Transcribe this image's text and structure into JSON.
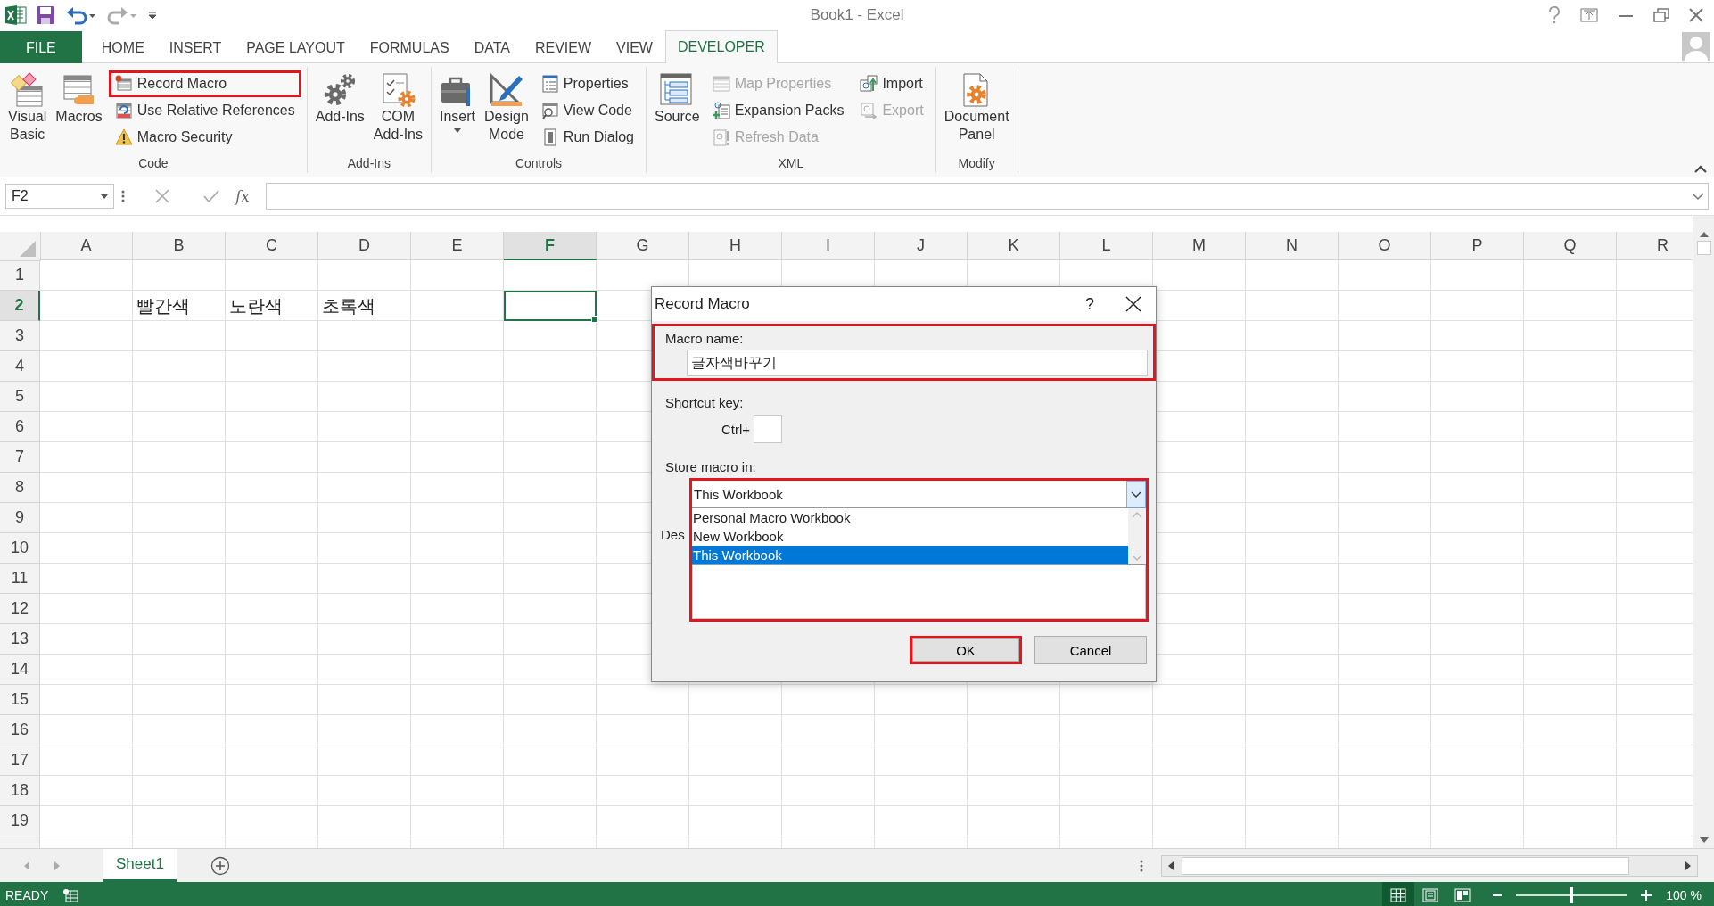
{
  "window": {
    "title": "Book1 - Excel"
  },
  "tabs": [
    {
      "label": "FILE",
      "kind": "file",
      "selected": false
    },
    {
      "label": "HOME",
      "kind": "tab",
      "selected": false
    },
    {
      "label": "INSERT",
      "kind": "tab",
      "selected": false
    },
    {
      "label": "PAGE LAYOUT",
      "kind": "tab",
      "selected": false
    },
    {
      "label": "FORMULAS",
      "kind": "tab",
      "selected": false
    },
    {
      "label": "DATA",
      "kind": "tab",
      "selected": false
    },
    {
      "label": "REVIEW",
      "kind": "tab",
      "selected": false
    },
    {
      "label": "VIEW",
      "kind": "tab",
      "selected": false
    },
    {
      "label": "DEVELOPER",
      "kind": "tab",
      "selected": true
    }
  ],
  "ribbon": {
    "groups": [
      {
        "label": "Code",
        "items": [
          {
            "label": "Visual Basic",
            "kind": "large",
            "dropdown": false,
            "disabled": false,
            "highlighted": false
          },
          {
            "label": "Macros",
            "kind": "large",
            "dropdown": false,
            "disabled": false,
            "highlighted": false
          },
          {
            "label": "Record Macro",
            "kind": "small",
            "dropdown": false,
            "disabled": false,
            "highlighted": true
          },
          {
            "label": "Use Relative References",
            "kind": "small",
            "dropdown": false,
            "disabled": false,
            "highlighted": false
          },
          {
            "label": "Macro Security",
            "kind": "small",
            "dropdown": false,
            "disabled": false,
            "highlighted": false
          }
        ]
      },
      {
        "label": "Add-Ins",
        "items": [
          {
            "label": "Add-Ins",
            "kind": "large",
            "dropdown": false,
            "disabled": false,
            "highlighted": false
          },
          {
            "label": "COM Add-Ins",
            "kind": "large",
            "dropdown": false,
            "disabled": false,
            "highlighted": false
          }
        ]
      },
      {
        "label": "Controls",
        "items": [
          {
            "label": "Insert",
            "kind": "large",
            "dropdown": true,
            "disabled": false,
            "highlighted": false
          },
          {
            "label": "Design Mode",
            "kind": "large",
            "dropdown": false,
            "disabled": false,
            "highlighted": false
          },
          {
            "label": "Properties",
            "kind": "small",
            "dropdown": false,
            "disabled": false,
            "highlighted": false
          },
          {
            "label": "View Code",
            "kind": "small",
            "dropdown": false,
            "disabled": false,
            "highlighted": false
          },
          {
            "label": "Run Dialog",
            "kind": "small",
            "dropdown": false,
            "disabled": false,
            "highlighted": false
          }
        ]
      },
      {
        "label": "XML",
        "items": [
          {
            "label": "Source",
            "kind": "large",
            "dropdown": false,
            "disabled": false,
            "highlighted": false
          },
          {
            "label": "Map Properties",
            "kind": "small",
            "dropdown": false,
            "disabled": true,
            "highlighted": false
          },
          {
            "label": "Expansion Packs",
            "kind": "small",
            "dropdown": false,
            "disabled": false,
            "highlighted": false
          },
          {
            "label": "Refresh Data",
            "kind": "small",
            "dropdown": false,
            "disabled": true,
            "highlighted": false
          },
          {
            "label": "Import",
            "kind": "small",
            "dropdown": false,
            "disabled": false,
            "highlighted": false
          },
          {
            "label": "Export",
            "kind": "small",
            "dropdown": false,
            "disabled": true,
            "highlighted": false
          }
        ]
      },
      {
        "label": "Modify",
        "items": [
          {
            "label": "Document Panel",
            "kind": "large",
            "dropdown": false,
            "disabled": false,
            "highlighted": false
          }
        ]
      }
    ]
  },
  "formula_bar": {
    "name_box": "F2",
    "function_label": "fx"
  },
  "sheet": {
    "columns": [
      {
        "label": "A",
        "selected": false
      },
      {
        "label": "B",
        "selected": false
      },
      {
        "label": "C",
        "selected": false
      },
      {
        "label": "D",
        "selected": false
      },
      {
        "label": "E",
        "selected": false
      },
      {
        "label": "F",
        "selected": true
      },
      {
        "label": "G",
        "selected": false
      },
      {
        "label": "H",
        "selected": false
      },
      {
        "label": "I",
        "selected": false
      },
      {
        "label": "J",
        "selected": false
      },
      {
        "label": "K",
        "selected": false
      },
      {
        "label": "L",
        "selected": false
      },
      {
        "label": "M",
        "selected": false
      },
      {
        "label": "N",
        "selected": false
      },
      {
        "label": "O",
        "selected": false
      },
      {
        "label": "P",
        "selected": false
      },
      {
        "label": "Q",
        "selected": false
      },
      {
        "label": "R",
        "selected": false
      }
    ],
    "rows": [
      {
        "label": "1",
        "selected": false
      },
      {
        "label": "2",
        "selected": true,
        "values": [
          "빨간색",
          "노란색",
          "초록색"
        ]
      },
      {
        "label": "3",
        "selected": false
      },
      {
        "label": "4",
        "selected": false
      },
      {
        "label": "5",
        "selected": false
      },
      {
        "label": "6",
        "selected": false
      },
      {
        "label": "7",
        "selected": false
      },
      {
        "label": "8",
        "selected": false
      },
      {
        "label": "9",
        "selected": false
      },
      {
        "label": "10",
        "selected": false
      },
      {
        "label": "11",
        "selected": false
      },
      {
        "label": "12",
        "selected": false
      },
      {
        "label": "13",
        "selected": false
      },
      {
        "label": "14",
        "selected": false
      },
      {
        "label": "15",
        "selected": false
      },
      {
        "label": "16",
        "selected": false
      },
      {
        "label": "17",
        "selected": false
      },
      {
        "label": "18",
        "selected": false
      },
      {
        "label": "19",
        "selected": false
      }
    ]
  },
  "sheet_tabs": [
    {
      "label": "Sheet1",
      "selected": true
    }
  ],
  "status_bar": {
    "mode": "READY",
    "views": [
      {
        "kind": "normal",
        "selected": true
      },
      {
        "kind": "page_layout",
        "selected": false
      },
      {
        "kind": "page_break",
        "selected": false
      }
    ],
    "zoom": {
      "level": 0.5,
      "label": "100 %"
    }
  },
  "dialog": {
    "title": "Record Macro",
    "help": "?",
    "macro_name": {
      "label": "Macro name:",
      "value": "글자색바꾸기",
      "highlighted": true
    },
    "shortcut": {
      "label": "Shortcut key:",
      "prefix": "Ctrl+"
    },
    "store": {
      "label": "Store macro in:",
      "value": "This Workbook",
      "highlighted": true,
      "options": [
        {
          "label": "Personal Macro Workbook",
          "selected": false
        },
        {
          "label": "New Workbook",
          "selected": false
        },
        {
          "label": "This Workbook",
          "selected": true
        }
      ]
    },
    "description": {
      "label": "Des"
    },
    "buttons": [
      {
        "label": "OK",
        "highlighted": true
      },
      {
        "label": "Cancel",
        "highlighted": false
      }
    ]
  }
}
